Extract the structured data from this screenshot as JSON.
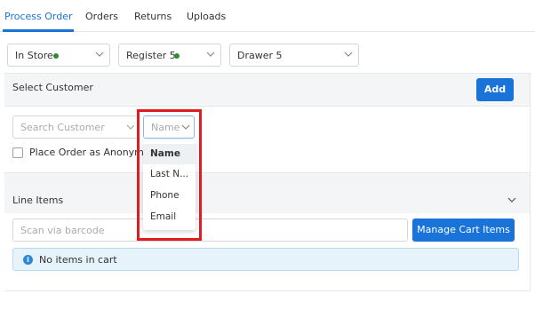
{
  "tabs": [
    {
      "label": "Process Order",
      "active": true
    },
    {
      "label": "Orders",
      "active": false
    },
    {
      "label": "Returns",
      "active": false
    },
    {
      "label": "Uploads",
      "active": false
    }
  ],
  "selectors": {
    "store": {
      "value": "In Store",
      "status_color": "#2e8b2e"
    },
    "register": {
      "value": "Register 5",
      "status_color": "#2e8b2e"
    },
    "drawer": {
      "value": "Drawer 5"
    }
  },
  "customer": {
    "section_label": "Select Customer",
    "add_label": "Add",
    "search_placeholder": "Search Customer",
    "field_select_placeholder": "Name",
    "anonymous_label": "Place Order as Anonymous",
    "field_options": [
      "Name",
      "Last N...",
      "Phone",
      "Email"
    ],
    "selected_option": "Name"
  },
  "line_items": {
    "section_label": "Line Items",
    "barcode_placeholder": "Scan via barcode",
    "manage_label": "Manage Cart Items",
    "empty_message": "No items in cart",
    "info_icon": "i"
  },
  "colors": {
    "accent": "#1a73d9",
    "highlight": "#e01b22"
  }
}
